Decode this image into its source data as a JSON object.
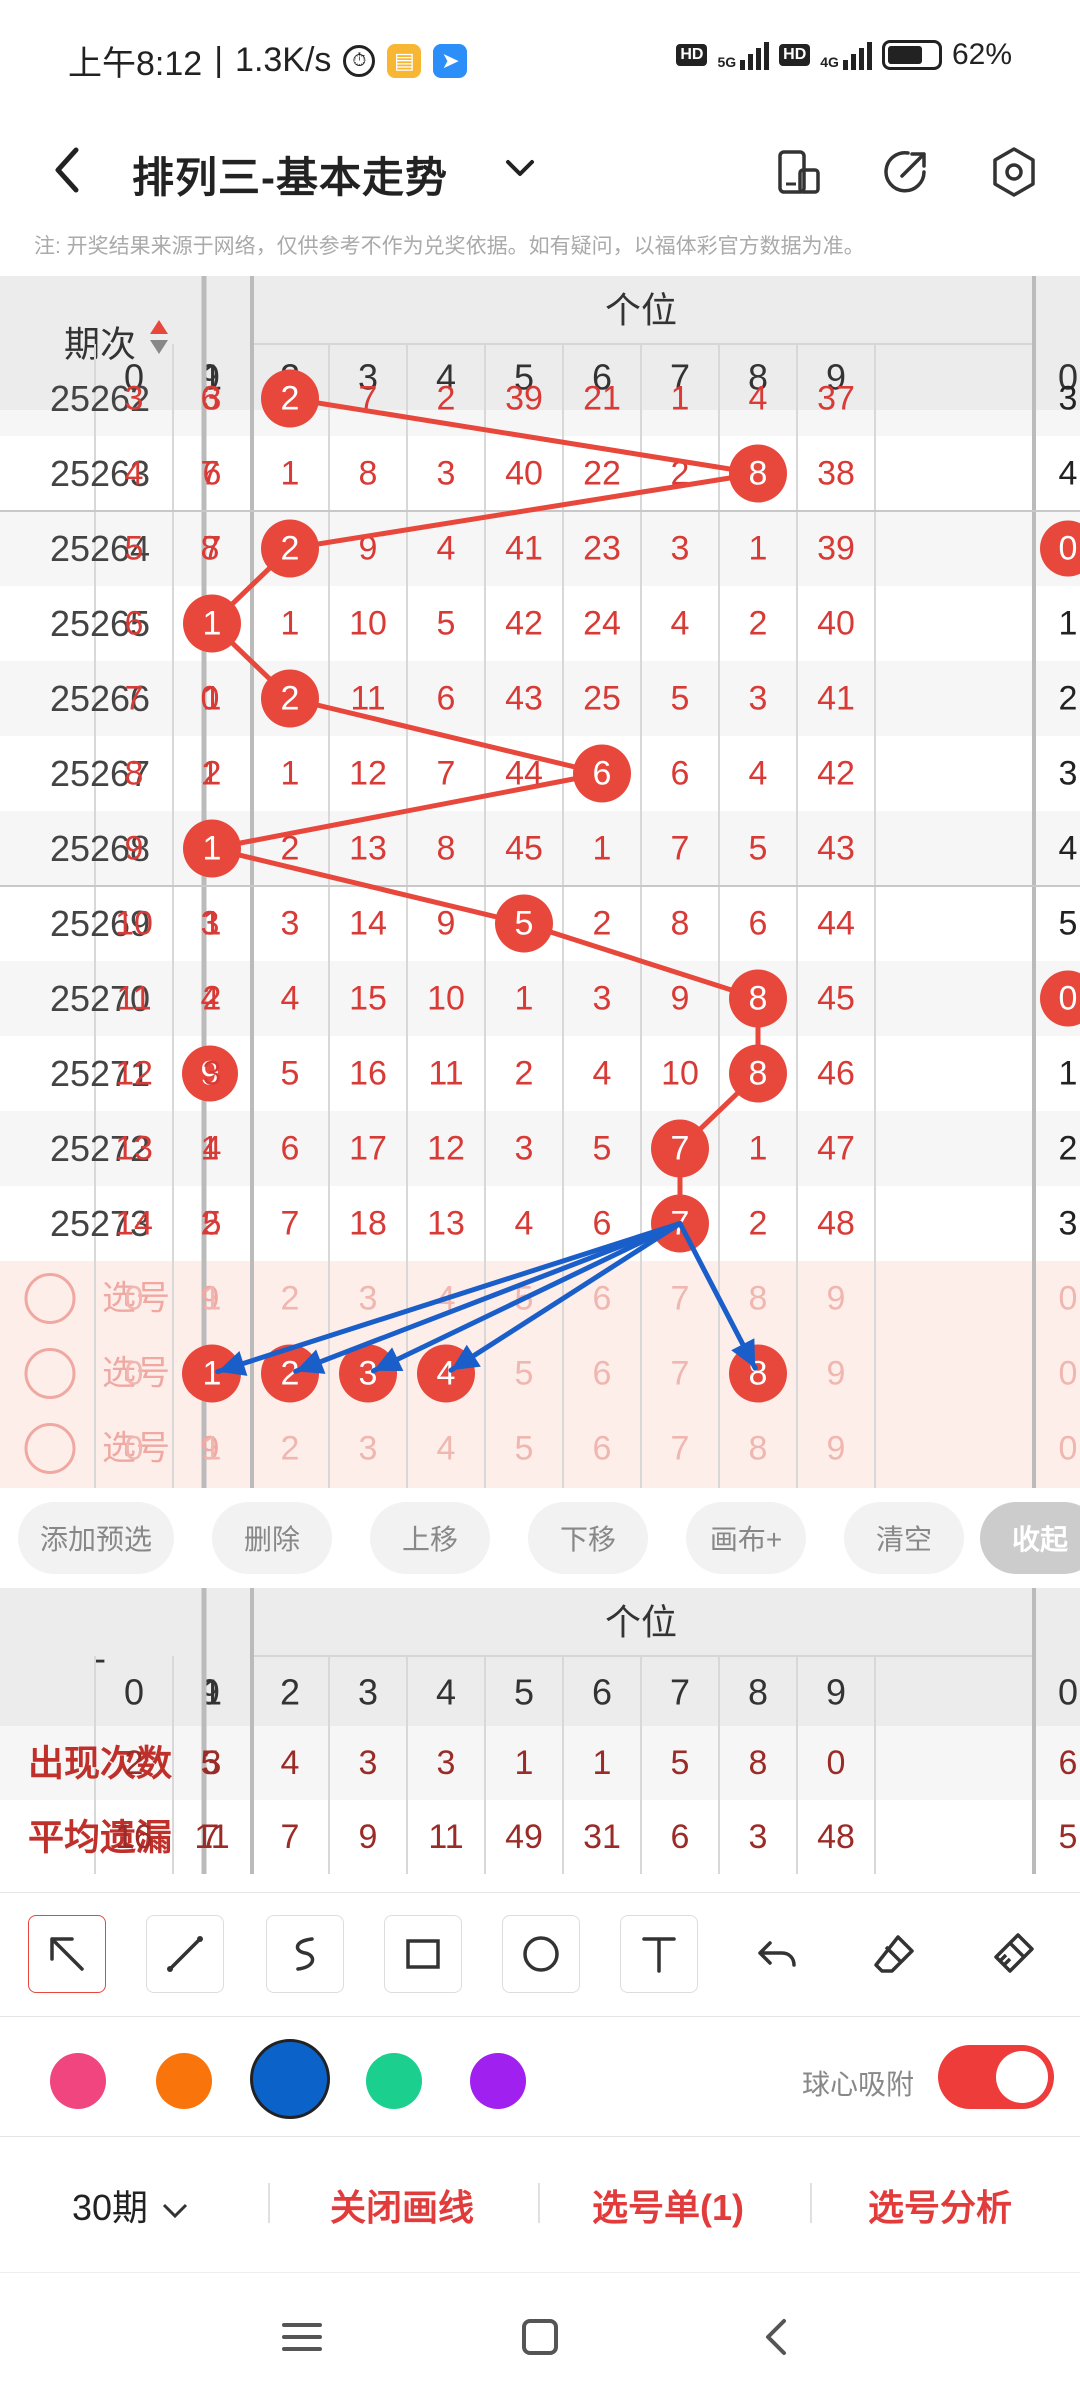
{
  "status_bar": {
    "time": "上午8:12",
    "speed": "1.3K/s",
    "network1": "5G",
    "network2": "4G",
    "battery": "62%",
    "hd": "HD"
  },
  "nav": {
    "title": "排列三-基本走势",
    "back_icon": "chevron-left-icon",
    "caret_icon": "chevron-down-icon",
    "tools": [
      "phone-landscape-icon",
      "share-icon",
      "settings-icon"
    ]
  },
  "notice": "注: 开奖结果来源于网络，仅供参考不作为兑奖依据。如有疑问，以福体彩官方数据为准。",
  "chart": {
    "period_header": "期次",
    "section_title": "个位",
    "prev_col_header": "9",
    "next_col_header": "0",
    "digits": [
      "0",
      "1",
      "2",
      "3",
      "4",
      "5",
      "6",
      "7",
      "8",
      "9"
    ],
    "rows": [
      {
        "period": "25262",
        "prev": "6",
        "cells": [
          "3",
          "3",
          "2",
          "7",
          "2",
          "39",
          "21",
          "1",
          "4",
          "37"
        ],
        "hit": 2,
        "next": "3"
      },
      {
        "period": "25263",
        "prev": "7",
        "cells": [
          "4",
          "6",
          "1",
          "8",
          "3",
          "40",
          "22",
          "2",
          "8",
          "38"
        ],
        "hit": 8,
        "next": "4"
      },
      {
        "period": "25264",
        "prev": "8",
        "cells": [
          "5",
          "7",
          "2",
          "9",
          "4",
          "41",
          "23",
          "3",
          "1",
          "39"
        ],
        "hit": 2,
        "next": "0"
      },
      {
        "period": "25265",
        "prev": "9",
        "cells": [
          "6",
          "1",
          "1",
          "10",
          "5",
          "42",
          "24",
          "4",
          "2",
          "40"
        ],
        "hit": 1,
        "next": "1"
      },
      {
        "period": "25266",
        "prev": "0",
        "cells": [
          "7",
          "1",
          "2",
          "11",
          "6",
          "43",
          "25",
          "5",
          "3",
          "41"
        ],
        "hit": 2,
        "next": "2"
      },
      {
        "period": "25267",
        "prev": "1",
        "cells": [
          "8",
          "2",
          "1",
          "12",
          "7",
          "44",
          "6",
          "6",
          "4",
          "42"
        ],
        "hit": 6,
        "next": "3"
      },
      {
        "period": "25268",
        "prev": "2",
        "cells": [
          "9",
          "1",
          "2",
          "13",
          "8",
          "45",
          "1",
          "7",
          "5",
          "43"
        ],
        "hit": 1,
        "next": "4"
      },
      {
        "period": "25269",
        "prev": "3",
        "cells": [
          "10",
          "1",
          "3",
          "14",
          "9",
          "5",
          "2",
          "8",
          "6",
          "44"
        ],
        "hit": 5,
        "next": "5"
      },
      {
        "period": "25270",
        "prev": "4",
        "cells": [
          "11",
          "2",
          "4",
          "15",
          "10",
          "1",
          "3",
          "9",
          "8",
          "45"
        ],
        "hit": 8,
        "next": "0"
      },
      {
        "period": "25271",
        "prev": "9",
        "cells": [
          "12",
          "3",
          "5",
          "16",
          "11",
          "2",
          "4",
          "10",
          "8",
          "46"
        ],
        "hit": 8,
        "next": "1"
      },
      {
        "period": "25272",
        "prev": "1",
        "cells": [
          "13",
          "4",
          "6",
          "17",
          "12",
          "3",
          "5",
          "7",
          "1",
          "47"
        ],
        "hit": 7,
        "next": "2"
      },
      {
        "period": "25273",
        "prev": "2",
        "cells": [
          "14",
          "5",
          "7",
          "18",
          "13",
          "4",
          "6",
          "7",
          "2",
          "48"
        ],
        "hit": 7,
        "next": "3"
      }
    ],
    "prev_hits": [
      false,
      false,
      false,
      false,
      false,
      false,
      false,
      false,
      false,
      true,
      false,
      false
    ],
    "next_hits": [
      false,
      false,
      true,
      false,
      false,
      false,
      false,
      false,
      true,
      false,
      false,
      false
    ],
    "pick_rows": [
      {
        "label": "选号",
        "prev": "9",
        "digits": [
          "0",
          "1",
          "2",
          "3",
          "4",
          "5",
          "6",
          "7",
          "8",
          "9"
        ],
        "selected": [],
        "next": "0"
      },
      {
        "label": "选号",
        "prev": "9",
        "digits": [
          "0",
          "1",
          "2",
          "3",
          "4",
          "5",
          "6",
          "7",
          "8",
          "9"
        ],
        "selected": [
          1,
          2,
          3,
          4,
          8
        ],
        "next": "0",
        "prev_selected": true
      },
      {
        "label": "选号",
        "prev": "9",
        "digits": [
          "0",
          "1",
          "2",
          "3",
          "4",
          "5",
          "6",
          "7",
          "8",
          "9"
        ],
        "selected": [],
        "next": "0"
      }
    ]
  },
  "buttons": [
    "添加预选",
    "删除",
    "上移",
    "下移",
    "画布+",
    "清空",
    "收起"
  ],
  "stats": {
    "corner": "-",
    "section_title": "个位",
    "prev_col_header": "9",
    "next_col_header": "0",
    "digits": [
      "0",
      "1",
      "2",
      "3",
      "4",
      "5",
      "6",
      "7",
      "8",
      "9"
    ],
    "rows": [
      {
        "label": "出现次数",
        "prev": "5",
        "values": [
          "2",
          "3",
          "4",
          "3",
          "3",
          "1",
          "1",
          "5",
          "8",
          "0"
        ],
        "next": "6"
      },
      {
        "label": "平均遗漏",
        "prev": "7",
        "values": [
          "16",
          "11",
          "7",
          "9",
          "11",
          "49",
          "31",
          "6",
          "3",
          "48"
        ],
        "next": "5"
      }
    ]
  },
  "draw_tools": [
    "arrow-pointer-icon",
    "line-icon",
    "freehand-icon",
    "rectangle-icon",
    "circle-icon",
    "text-icon",
    "undo-icon",
    "eraser-icon",
    "clear-brush-icon"
  ],
  "palette": [
    "#f0457f",
    "#f9740b",
    "#0b62c9",
    "#1bcf8e",
    "#a020ef"
  ],
  "selected_color": "#0b62c9",
  "snap": {
    "label": "球心吸附",
    "on": true
  },
  "actions": {
    "period_count": "30期",
    "close_draw": "关闭画线",
    "pick_list": "选号单(1)",
    "pick_analysis": "选号分析"
  },
  "colors": {
    "red": "#e8473c",
    "blue": "#1a5fc9",
    "red_text": "#d83a36"
  }
}
